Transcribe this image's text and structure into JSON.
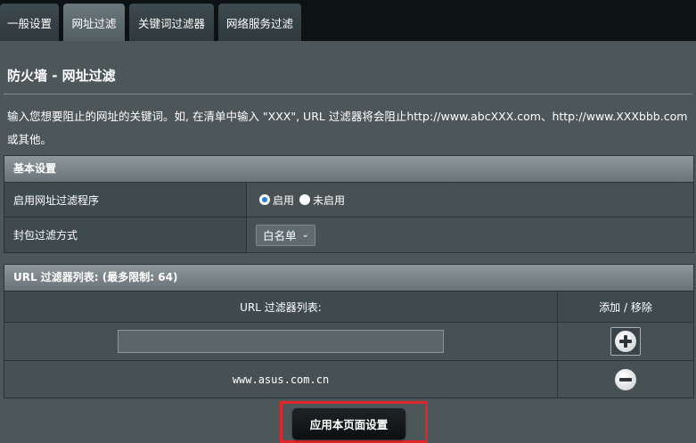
{
  "tabs": [
    {
      "label": "一般设置",
      "active": false
    },
    {
      "label": "网址过滤",
      "active": true
    },
    {
      "label": "关键词过滤器",
      "active": false
    },
    {
      "label": "网络服务过滤",
      "active": false
    }
  ],
  "page": {
    "title": "防火墙 - 网址过滤",
    "description": "输入您想要阻止的网址的关键词。如, 在清单中输入 \"XXX\", URL 过滤器将会阻止http://www.abcXXX.com、http://www.XXXbbb.com 或其他。"
  },
  "basic": {
    "header": "基本设置",
    "enable_label": "启用网址过滤程序",
    "enable_on": "启用",
    "enable_off": "未启用",
    "enabled": true,
    "mode_label": "封包过滤方式",
    "mode_value": "白名单"
  },
  "url_list": {
    "header": "URL 过滤器列表: (最多限制: 64)",
    "col_url": "URL 过滤器列表:",
    "col_action": "添加 / 移除",
    "input_value": "",
    "entries": [
      "www.asus.com.cn"
    ]
  },
  "apply_label": "应用本页面设置",
  "colors": {
    "background": "#4d5659",
    "tabbar": "#0d1214",
    "highlight": "#e0262a",
    "radio_selected": "#2b7cd6"
  }
}
